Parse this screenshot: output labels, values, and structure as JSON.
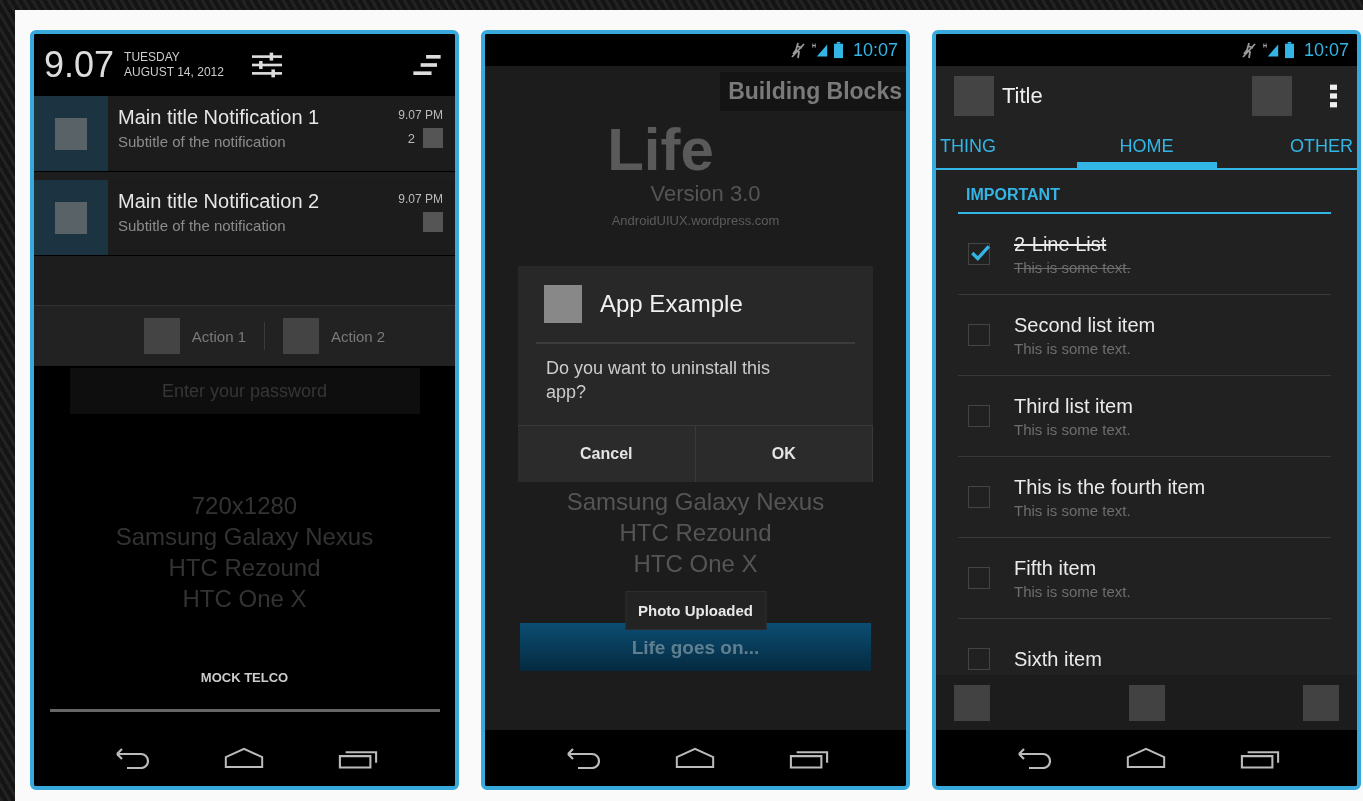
{
  "notification_screen": {
    "clock": "9.07",
    "weekday": "TUESDAY",
    "date": "AUGUST 14, 2012",
    "notifications": [
      {
        "title": "Main title Notification 1",
        "subtitle": "Subtitle of the notification",
        "time": "9.07 PM",
        "count": "2"
      },
      {
        "title": "Main title Notification 2",
        "subtitle": "Subtitle of the notification",
        "time": "9.07 PM"
      }
    ],
    "actions": [
      "Action 1",
      "Action 2"
    ],
    "password_field": {
      "placeholder": "Enter your password"
    },
    "background_lines": [
      "720x1280",
      "Samsung Galaxy Nexus",
      "HTC Rezound",
      "HTC One X"
    ],
    "carrier": "MOCK TELCO"
  },
  "dialog_screen": {
    "status_time": "10:07",
    "badge": "Building Blocks",
    "app_name": "Life",
    "version": "Version 3.0",
    "website": "AndroidUIUX.wordpress.com",
    "dialog": {
      "title": "App Example",
      "message": "Do you want to uninstall this app?",
      "buttons": [
        "Cancel",
        "OK"
      ]
    },
    "devices": [
      "Samsung Galaxy Nexus",
      "HTC Rezound",
      "HTC One X"
    ],
    "toast": "Photo Uploaded",
    "main_button": "Life goes on..."
  },
  "list_screen": {
    "status_time": "10:07",
    "title": "Title",
    "tabs": [
      {
        "label": "THING",
        "selected": false
      },
      {
        "label": "HOME",
        "selected": true
      },
      {
        "label": "OTHER",
        "selected": false
      }
    ],
    "section": "IMPORTANT",
    "items": [
      {
        "title": "2-Line List",
        "subtitle": "This is some text.",
        "checked": true
      },
      {
        "title": "Second list item",
        "subtitle": "This is some text.",
        "checked": false
      },
      {
        "title": "Third list item",
        "subtitle": "This is some text.",
        "checked": false
      },
      {
        "title": "This is the fourth item",
        "subtitle": "This is some text.",
        "checked": false
      },
      {
        "title": "Fifth item",
        "subtitle": "This is some text.",
        "checked": false
      },
      {
        "title": "Sixth item",
        "checked": false
      }
    ]
  }
}
